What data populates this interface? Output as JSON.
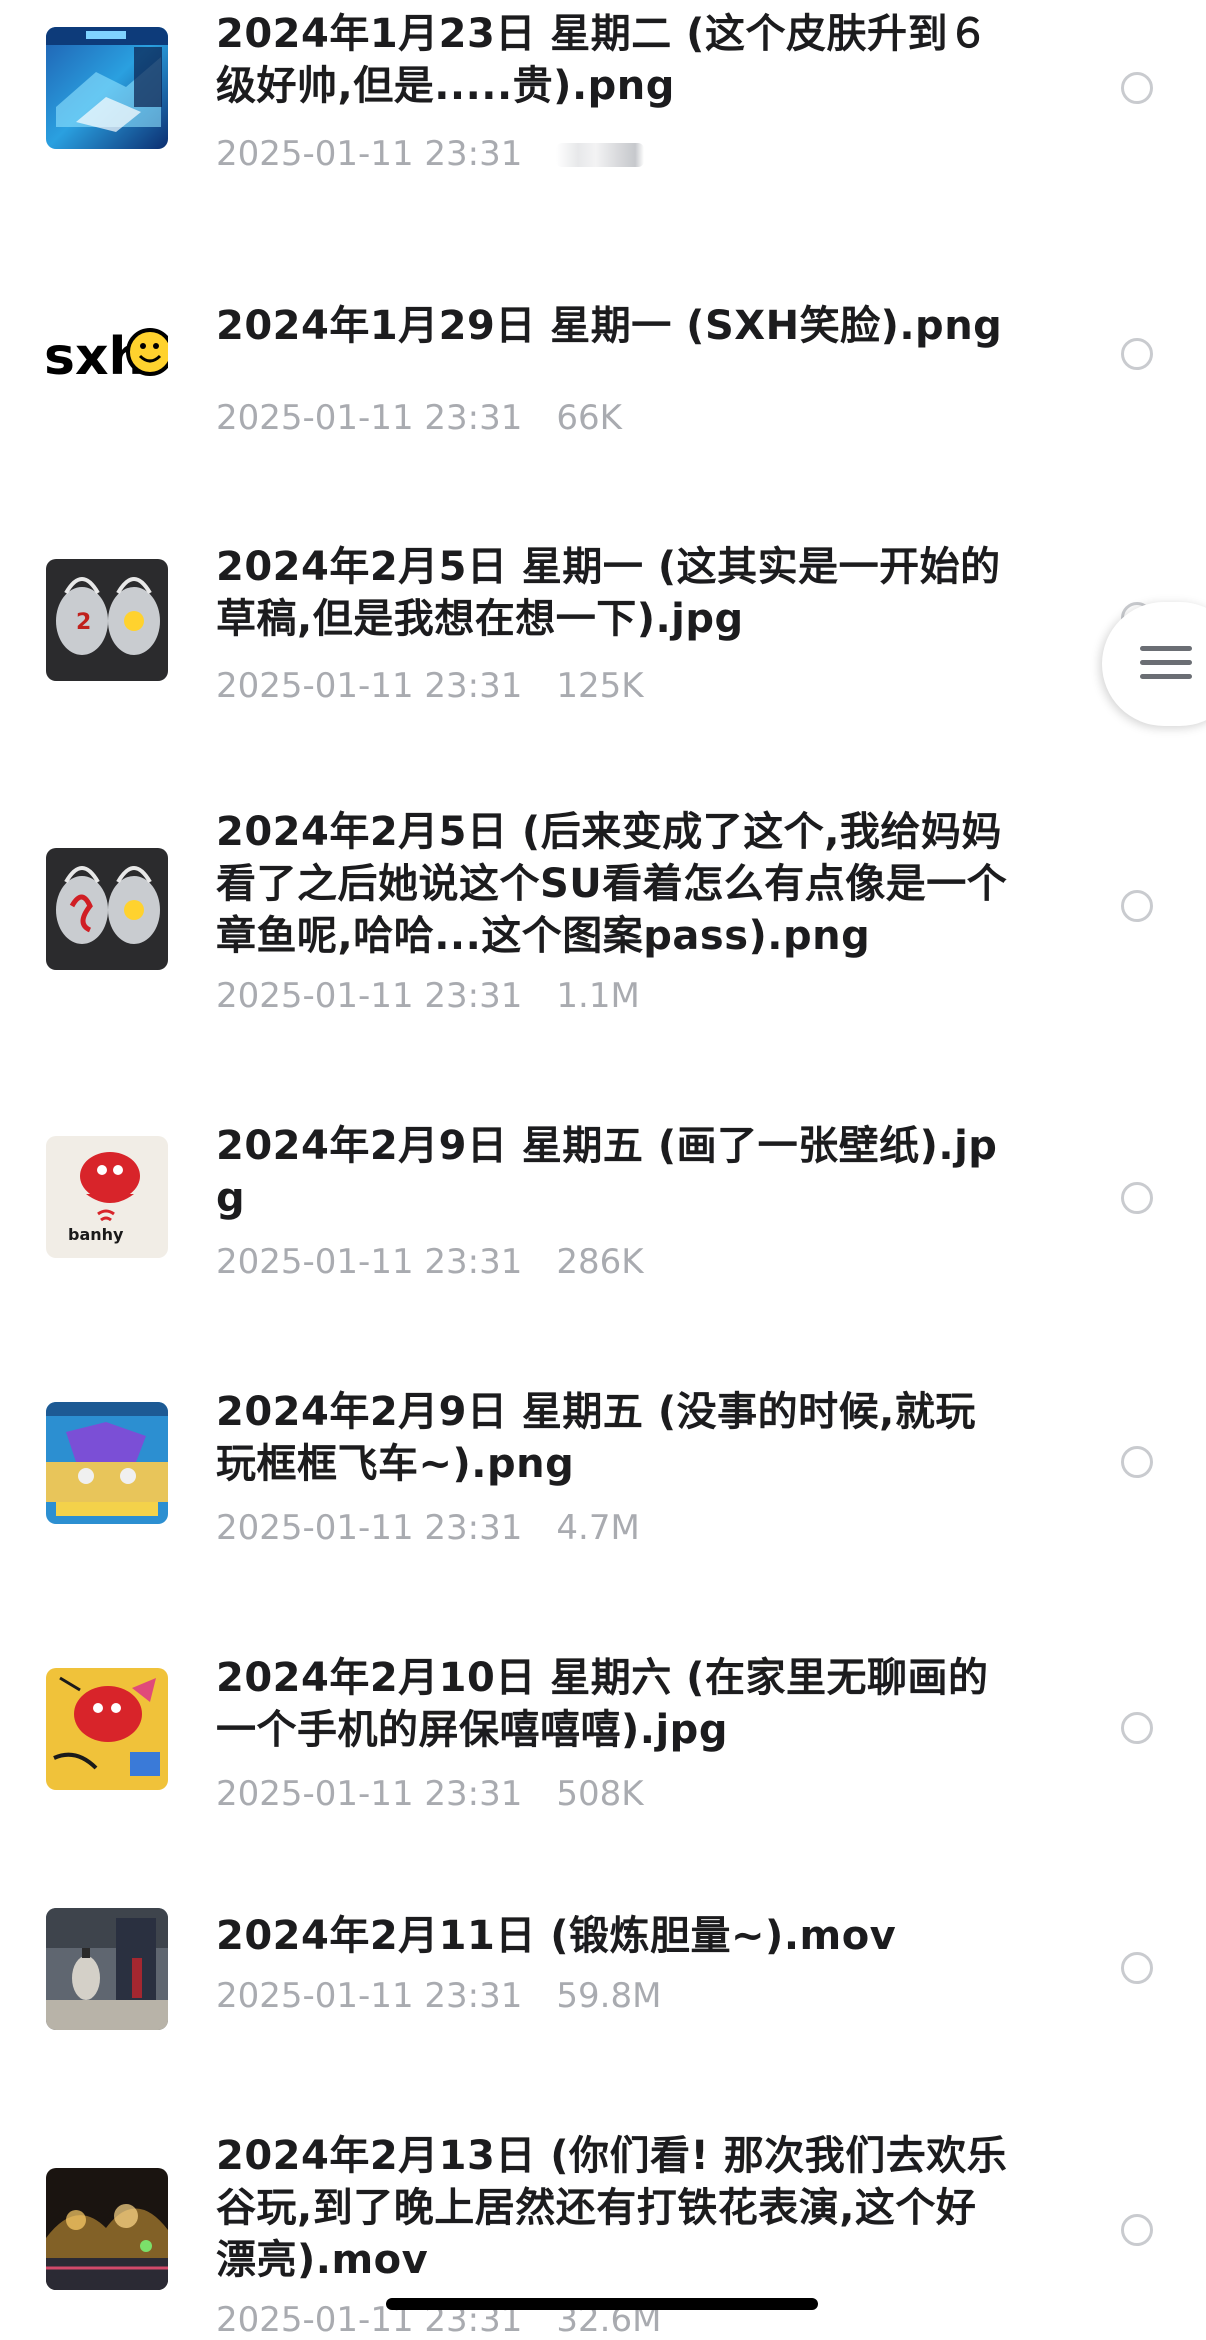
{
  "files": [
    {
      "title": "2024年1月23日 星期二 (这个皮肤升到６级好帅,但是.....贵).png",
      "date": "2025-01-11 23:31",
      "size": "",
      "thumb": "game-skin-thumbnail"
    },
    {
      "title": "2024年1月29日 星期一 (SXH笑脸).png",
      "date": "2025-01-11 23:31",
      "size": "66K",
      "thumb": "sxh-smiley-logo-thumbnail"
    },
    {
      "title": "2024年2月5日 星期一 (这其实是一开始的草稿,但是我想在想一下).jpg",
      "date": "2025-01-11 23:31",
      "size": "125K",
      "thumb": "earphones-draft-thumbnail"
    },
    {
      "title": "2024年2月5日 (后来变成了这个,我给妈妈看了之后她说这个SU看着怎么有点像是一个章鱼呢,哈哈...这个图案pass).png",
      "date": "2025-01-11 23:31",
      "size": "1.1M",
      "thumb": "earphones-su-thumbnail"
    },
    {
      "title": "2024年2月9日 星期五 (画了一张壁纸).jpg",
      "date": "2025-01-11 23:31",
      "size": "286K",
      "thumb": "red-character-wallpaper-thumbnail"
    },
    {
      "title": "2024年2月9日 星期五 (没事的时候,就玩玩框框飞车~).png",
      "date": "2025-01-11 23:31",
      "size": "4.7M",
      "thumb": "racing-game-thumbnail"
    },
    {
      "title": "2024年2月10日 星期六 (在家里无聊画的一个手机的屏保嘻嘻嘻).jpg",
      "date": "2025-01-11 23:31",
      "size": "508K",
      "thumb": "phone-screensaver-thumbnail"
    },
    {
      "title": "2024年2月11日 (锻炼胆量~).mov",
      "date": "2025-01-11 23:31",
      "size": "59.8M",
      "thumb": "mall-video-thumbnail"
    },
    {
      "title": "2024年2月13日 (你们看! 那次我们去欢乐谷玩,到了晚上居然还有打铁花表演,这个好漂亮).mov",
      "date": "2025-01-11 23:31",
      "size": "32.6M",
      "thumb": "fireworks-video-thumbnail"
    }
  ],
  "side_menu_icon": "hamburger-menu-icon",
  "colors": {
    "title": "#1c1c1e",
    "meta": "#a9abb0",
    "radio_border": "#c9cbcf"
  }
}
